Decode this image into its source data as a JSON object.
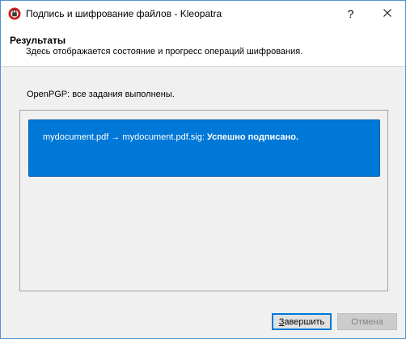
{
  "window": {
    "title": "Подпись и шифрование файлов - Kleopatra",
    "help_glyph": "?",
    "close_glyph": "✕"
  },
  "header": {
    "title": "Результаты",
    "subtitle": "Здесь отображается состояние и прогресс операций шифрования."
  },
  "status": {
    "text": "OpenPGP: все задания выполнены."
  },
  "results": [
    {
      "files": "mydocument.pdf → mydocument.pdf.sig:",
      "result": "Успешно подписано."
    }
  ],
  "buttons": {
    "finish_mnemonic": "З",
    "finish_rest": "авершить",
    "cancel": "Отмена"
  },
  "colors": {
    "accent": "#0078d7",
    "window_bg": "#f0f0f0",
    "app_icon": "#c8201e"
  },
  "icons": {
    "app": "kleopatra-app-icon",
    "help": "help-icon",
    "close": "close-icon"
  }
}
